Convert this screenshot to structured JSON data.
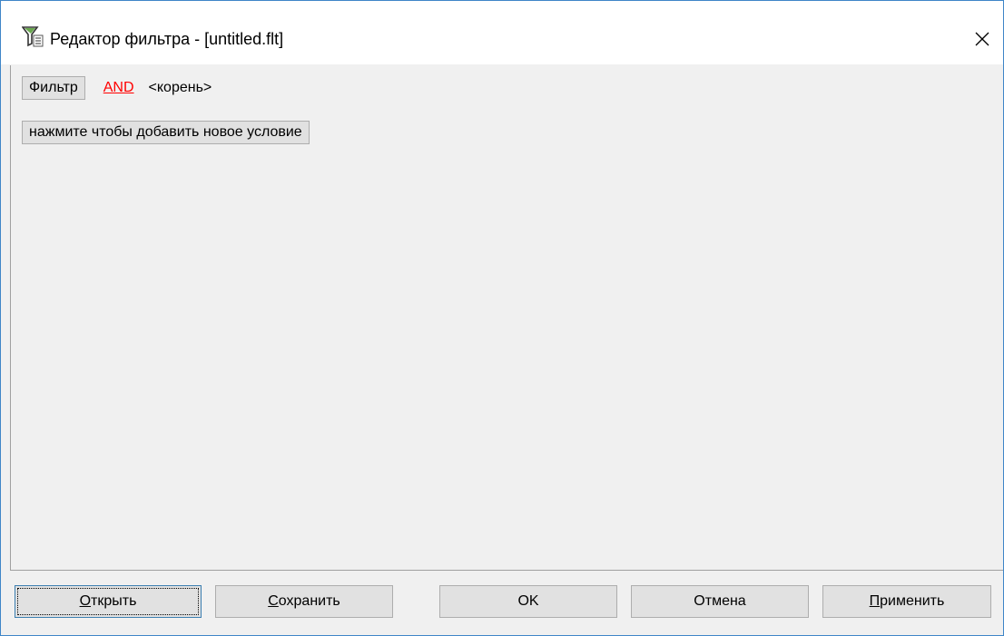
{
  "window": {
    "title": "Редактор фильтра - [untitled.flt]",
    "icon": "filter-funnel-icon",
    "close_glyph": "✕"
  },
  "filter": {
    "filter_button_label": "Фильтр",
    "operator_label": "AND",
    "root_label": "<корень>",
    "add_condition_label": "нажмите чтобы добавить новое условие"
  },
  "buttons": {
    "open": {
      "mnemonic": "О",
      "rest": "ткрыть"
    },
    "save": {
      "mnemonic": "С",
      "rest": "охранить"
    },
    "ok": "OK",
    "cancel": "Отмена",
    "apply": {
      "mnemonic": "П",
      "rest": "рименить"
    }
  },
  "colors": {
    "operator": "#ff0000",
    "window_border": "#3f86c8",
    "background": "#f0f0f0"
  }
}
